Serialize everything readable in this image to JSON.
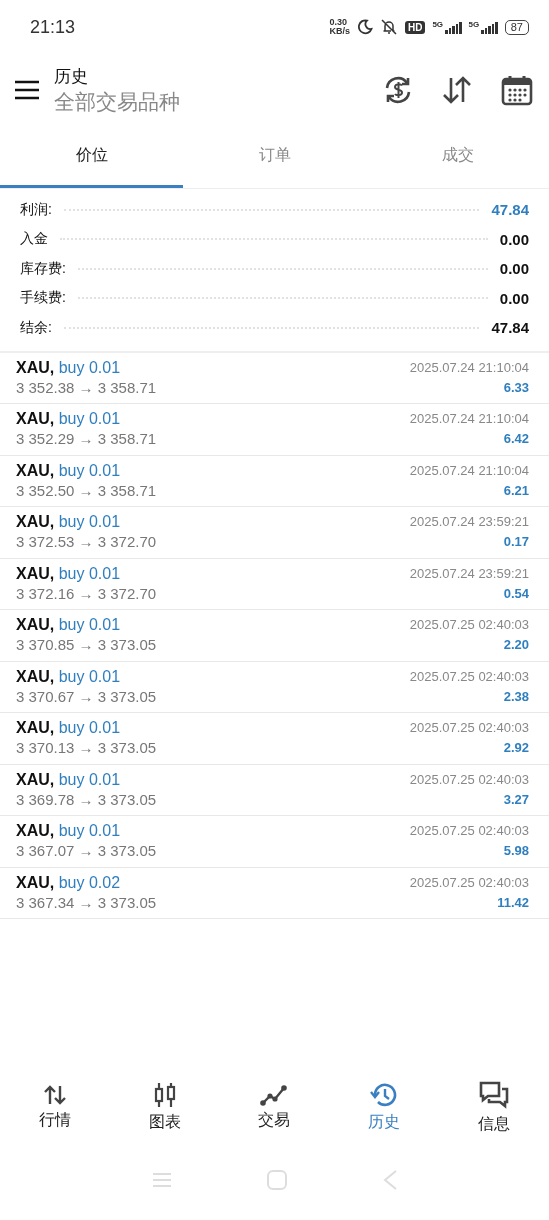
{
  "status_bar": {
    "time": "21:13",
    "net_speed_value": "0.30",
    "net_speed_unit": "KB/s",
    "hd_badge": "HD",
    "signal_1": "5G",
    "signal_2": "5G",
    "battery": "87"
  },
  "header": {
    "title": "历史",
    "subtitle": "全部交易品种"
  },
  "tabs": [
    {
      "label": "价位",
      "selected": true
    },
    {
      "label": "订单",
      "selected": false
    },
    {
      "label": "成交",
      "selected": false
    }
  ],
  "summary": [
    {
      "label": "利润:",
      "value": "47.84",
      "highlighted": true
    },
    {
      "label": "入金",
      "value": "0.00",
      "highlighted": false
    },
    {
      "label": "库存费:",
      "value": "0.00",
      "highlighted": false
    },
    {
      "label": "手续费:",
      "value": "0.00",
      "highlighted": false
    },
    {
      "label": "结余:",
      "value": "47.84",
      "highlighted": false
    }
  ],
  "trades": [
    {
      "symbol": "XAU,",
      "side": "buy 0.01",
      "prices": "3 352.38 → 3 358.71",
      "time": "2025.07.24 21:10:04",
      "profit": "6.33"
    },
    {
      "symbol": "XAU,",
      "side": "buy 0.01",
      "prices": "3 352.29 → 3 358.71",
      "time": "2025.07.24 21:10:04",
      "profit": "6.42"
    },
    {
      "symbol": "XAU,",
      "side": "buy 0.01",
      "prices": "3 352.50 → 3 358.71",
      "time": "2025.07.24 21:10:04",
      "profit": "6.21"
    },
    {
      "symbol": "XAU,",
      "side": "buy 0.01",
      "prices": "3 372.53 → 3 372.70",
      "time": "2025.07.24 23:59:21",
      "profit": "0.17"
    },
    {
      "symbol": "XAU,",
      "side": "buy 0.01",
      "prices": "3 372.16 → 3 372.70",
      "time": "2025.07.24 23:59:21",
      "profit": "0.54"
    },
    {
      "symbol": "XAU,",
      "side": "buy 0.01",
      "prices": "3 370.85 → 3 373.05",
      "time": "2025.07.25 02:40:03",
      "profit": "2.20"
    },
    {
      "symbol": "XAU,",
      "side": "buy 0.01",
      "prices": "3 370.67 → 3 373.05",
      "time": "2025.07.25 02:40:03",
      "profit": "2.38"
    },
    {
      "symbol": "XAU,",
      "side": "buy 0.01",
      "prices": "3 370.13 → 3 373.05",
      "time": "2025.07.25 02:40:03",
      "profit": "2.92"
    },
    {
      "symbol": "XAU,",
      "side": "buy 0.01",
      "prices": "3 369.78 → 3 373.05",
      "time": "2025.07.25 02:40:03",
      "profit": "3.27"
    },
    {
      "symbol": "XAU,",
      "side": "buy 0.01",
      "prices": "3 367.07 → 3 373.05",
      "time": "2025.07.25 02:40:03",
      "profit": "5.98"
    },
    {
      "symbol": "XAU,",
      "side": "buy 0.02",
      "prices": "3 367.34 → 3 373.05",
      "time": "2025.07.25 02:40:03",
      "profit": "11.42"
    }
  ],
  "bottom_nav": [
    {
      "label": "行情",
      "kind": "quotes",
      "selected": false
    },
    {
      "label": "图表",
      "kind": "chart",
      "selected": false
    },
    {
      "label": "交易",
      "kind": "trade",
      "selected": false
    },
    {
      "label": "历史",
      "kind": "history",
      "selected": true
    },
    {
      "label": "信息",
      "kind": "messages",
      "selected": false
    }
  ]
}
